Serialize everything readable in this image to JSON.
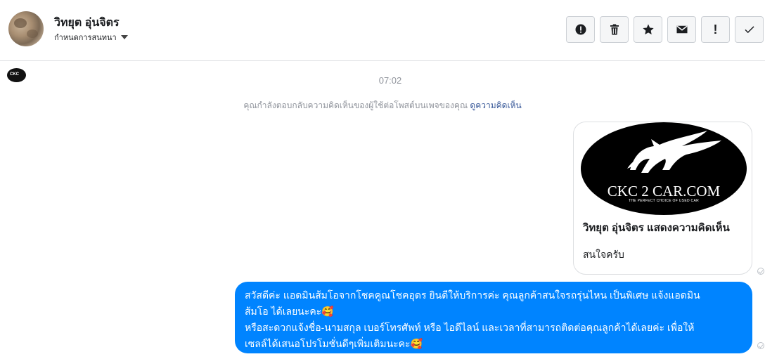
{
  "header": {
    "name": "วิทยุต อุ่นจิตร",
    "assign_label": "กำหนดการสนทนา"
  },
  "toolbar": {
    "buttons": [
      {
        "name": "spam-button",
        "icon": "alert-circle-icon"
      },
      {
        "name": "delete-button",
        "icon": "trash-icon"
      },
      {
        "name": "star-button",
        "icon": "star-icon"
      },
      {
        "name": "mark-unread-button",
        "icon": "envelope-icon"
      },
      {
        "name": "follow-up-button",
        "icon": "exclamation-icon",
        "label": "!"
      },
      {
        "name": "done-button",
        "icon": "check-icon"
      }
    ]
  },
  "conversation": {
    "time": "07:02",
    "notice_text": "คุณกำลังตอบกลับความคิดเห็นของผู้ใช้ต่อโพสต์บนเพจของคุณ",
    "notice_link": "ดูความคิดเห็น",
    "card": {
      "brand": "CKC 2 CAR.COM",
      "tagline": "THE PERFECT CHOICE OF USED CAR",
      "title": "วิทยุต อุ่นจิตร แสดงความคิดเห็น",
      "body": "สนใจครับ"
    },
    "reply": {
      "line1": "สวัสดีค่ะ แอดมินส้มโอจากโชคคูณโชคอุดร ยินดีให้บริการค่ะ   คุณลูกค้าสนใจรถรุ่นไหน เป็นพิเศษ แจ้งแอดมิน",
      "line2": "ส้มโอ ได้เลยนะคะ🥰",
      "line3": "หรือสะดวกแจ้งชื่อ-นามสกุล เบอร์โทรศัพท์ หรือ ไอดีไลน์ และเวลาที่สามารถติดต่อคุณลูกค้าได้เลยค่ะ เพื่อให้",
      "line4": "เซลล์ได้เสนอโปรโมชั่นดีๆเพิ่มเติมนะคะ🥰"
    }
  },
  "colors": {
    "bubble": "#0084ff",
    "link": "#385898",
    "muted": "#90949c"
  }
}
